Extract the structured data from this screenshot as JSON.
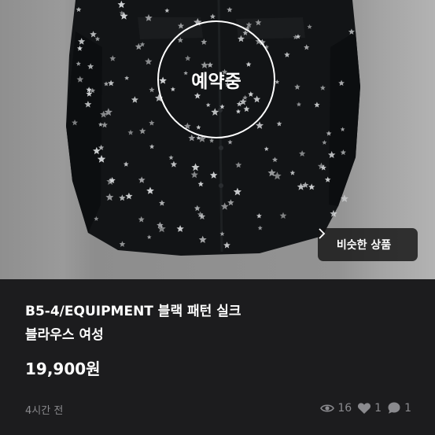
{
  "overlay": {
    "reserved_label": "예약중",
    "similar_button_label": "비슷한 상품",
    "similar_button_icon": "chevron-right-icon"
  },
  "product": {
    "title_line1": "B5-4/EQUIPMENT 블랙 패턴 실크",
    "title_line2": "블라우스 여성",
    "price": "19,900원",
    "posted_time": "4시간 전"
  },
  "stats": {
    "views": "16",
    "likes": "1",
    "chats": "1"
  },
  "colors": {
    "background": "#1c1c1e",
    "text": "#ffffff",
    "muted": "#8a8a8e"
  }
}
